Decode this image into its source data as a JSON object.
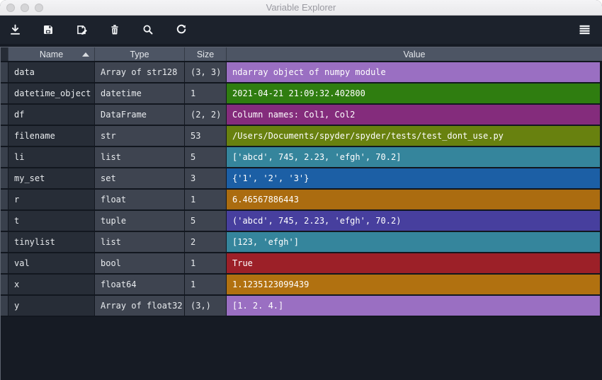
{
  "window": {
    "title": "Variable Explorer"
  },
  "titlebar": {
    "traffic_lights": [
      {
        "name": "close-button"
      },
      {
        "name": "minimize-button"
      },
      {
        "name": "maximize-button"
      }
    ]
  },
  "toolbar": {
    "buttons": [
      {
        "name": "import-data",
        "icon": "import-icon",
        "tooltip": "Import data"
      },
      {
        "name": "save-data",
        "icon": "save-icon",
        "tooltip": "Save data"
      },
      {
        "name": "save-data-as",
        "icon": "save-as-icon",
        "tooltip": "Save data as"
      },
      {
        "name": "remove-variable",
        "icon": "trash-icon",
        "tooltip": "Remove"
      },
      {
        "name": "search-variable",
        "icon": "search-icon",
        "tooltip": "Search"
      },
      {
        "name": "refresh-variables",
        "icon": "refresh-icon",
        "tooltip": "Refresh"
      }
    ],
    "menu": {
      "name": "options-menu",
      "icon": "hamburger-menu-icon",
      "tooltip": "Options"
    }
  },
  "table": {
    "columns": [
      {
        "label": "Name",
        "sort": "ascending"
      },
      {
        "label": "Type"
      },
      {
        "label": "Size"
      },
      {
        "label": "Value"
      }
    ],
    "rows": [
      {
        "name": "data",
        "type": "Array of str128",
        "size": "(3, 3)",
        "value": "ndarray object of numpy module",
        "color": "#9a6fc2"
      },
      {
        "name": "datetime_object",
        "type": "datetime",
        "size": "1",
        "value": "2021-04-21 21:09:32.402800",
        "color": "#2f7d10"
      },
      {
        "name": "df",
        "type": "DataFrame",
        "size": "(2, 2)",
        "value": "Column names: Col1, Col2",
        "color": "#842c7c"
      },
      {
        "name": "filename",
        "type": "str",
        "size": "53",
        "value": "/Users/Documents/spyder/spyder/tests/test_dont_use.py",
        "color": "#68810f"
      },
      {
        "name": "li",
        "type": "list",
        "size": "5",
        "value": "['abcd', 745, 2.23, 'efgh', 70.2]",
        "color": "#35859c"
      },
      {
        "name": "my_set",
        "type": "set",
        "size": "3",
        "value": "{'1', '2', '3'}",
        "color": "#1c5fa5"
      },
      {
        "name": "r",
        "type": "float",
        "size": "1",
        "value": "6.46567886443",
        "color": "#ab6c10"
      },
      {
        "name": "t",
        "type": "tuple",
        "size": "5",
        "value": "('abcd', 745, 2.23, 'efgh', 70.2)",
        "color": "#473f9e"
      },
      {
        "name": "tinylist",
        "type": "list",
        "size": "2",
        "value": "[123, 'efgh']",
        "color": "#35859c"
      },
      {
        "name": "val",
        "type": "bool",
        "size": "1",
        "value": "True",
        "color": "#9c2028"
      },
      {
        "name": "x",
        "type": "float64",
        "size": "1",
        "value": "1.1235123099439",
        "color": "#b17110"
      },
      {
        "name": "y",
        "type": "Array of float32",
        "size": "(3,)",
        "value": "[1. 2. 4.]",
        "color": "#9a6fc2"
      }
    ]
  },
  "colors": {
    "toolbar_bg": "#1c222c",
    "header_bg": "#4d5564",
    "name_cell_bg": "#272d37",
    "type_cell_bg": "#3e4450",
    "empty_bg": "#161b24"
  }
}
